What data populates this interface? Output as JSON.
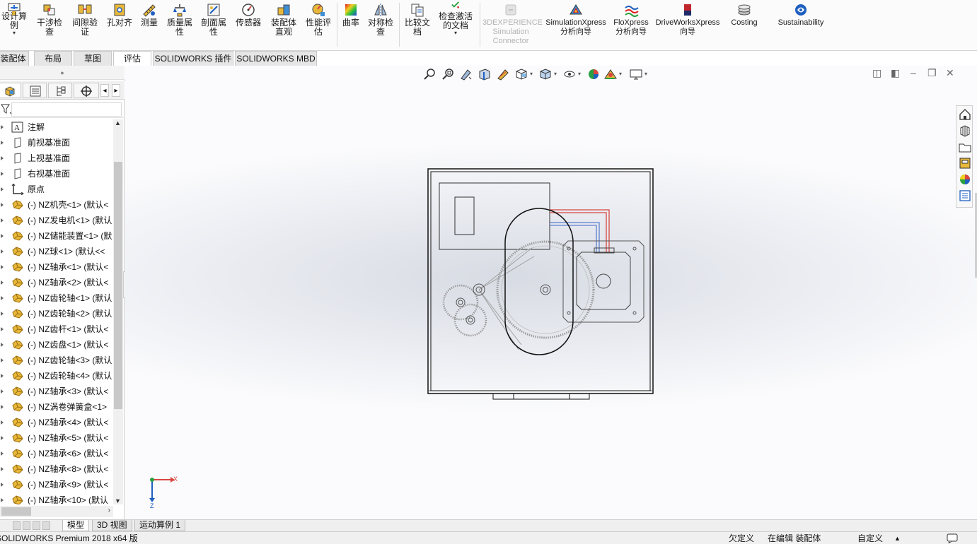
{
  "ribbon": {
    "buttons": [
      {
        "label": "设计算例",
        "icon": "design-study-icon",
        "dropdown": true
      },
      {
        "label": "干涉检查",
        "icon": "interference-check-icon"
      },
      {
        "label": "间隙验证",
        "icon": "clearance-verification-icon"
      },
      {
        "label": "孔对齐",
        "icon": "hole-alignment-icon"
      },
      {
        "label": "测量",
        "icon": "measure-icon"
      },
      {
        "label": "质量属性",
        "icon": "mass-properties-icon"
      },
      {
        "label": "剖面属性",
        "icon": "section-properties-icon"
      },
      {
        "label": "传感器",
        "icon": "sensor-icon"
      },
      {
        "label": "装配体直观",
        "icon": "assemblyxpert-icon"
      },
      {
        "label": "性能评估",
        "icon": "performance-evaluation-icon"
      },
      {
        "label": "曲率",
        "icon": "curvature-icon"
      },
      {
        "label": "对称检查",
        "icon": "symmetry-check-icon"
      },
      {
        "label": "比较文档",
        "icon": "compare-documents-icon"
      },
      {
        "label": "检查激活的文档",
        "icon": "check-active-document-icon",
        "dropdown": true
      },
      {
        "label": "3DEXPERIENCE Simulation Connector",
        "icon": "3dexperience-icon",
        "disabled": true
      },
      {
        "label": "SimulationXpress 分析向导",
        "icon": "simulationxpress-icon"
      },
      {
        "label": "FloXpress 分析向导",
        "icon": "floxpress-icon"
      },
      {
        "label": "DriveWorksXpress 向导",
        "icon": "driveworksxpress-icon"
      },
      {
        "label": "Costing",
        "icon": "costing-icon"
      },
      {
        "label": "Sustainability",
        "icon": "sustainability-icon"
      }
    ]
  },
  "tabs": [
    {
      "label": "装配体"
    },
    {
      "label": "布局"
    },
    {
      "label": "草图"
    },
    {
      "label": "评估",
      "active": true
    },
    {
      "label": "SOLIDWORKS 插件"
    },
    {
      "label": "SOLIDWORKS MBD"
    }
  ],
  "tree": {
    "items": [
      {
        "label": "注解",
        "icon": "annotation-icon"
      },
      {
        "label": "前视基准面",
        "icon": "plane-icon"
      },
      {
        "label": "上视基准面",
        "icon": "plane-icon"
      },
      {
        "label": "右视基准面",
        "icon": "plane-icon"
      },
      {
        "label": "原点",
        "icon": "origin-icon"
      },
      {
        "label": "(-) NZ机壳<1> (默认<",
        "icon": "part-icon"
      },
      {
        "label": "(-) NZ发电机<1> (默认",
        "icon": "part-icon"
      },
      {
        "label": "(-) NZ储能装置<1> (默",
        "icon": "part-icon"
      },
      {
        "label": "(-) NZ球<1> (默认<<",
        "icon": "part-icon"
      },
      {
        "label": "(-) NZ轴承<1> (默认<",
        "icon": "part-icon"
      },
      {
        "label": "(-) NZ轴承<2> (默认<",
        "icon": "part-icon"
      },
      {
        "label": "(-) NZ齿轮轴<1> (默认",
        "icon": "part-icon"
      },
      {
        "label": "(-) NZ齿轮轴<2> (默认",
        "icon": "part-icon"
      },
      {
        "label": "(-) NZ齿杆<1> (默认<",
        "icon": "part-icon"
      },
      {
        "label": "(-) NZ齿盘<1> (默认<",
        "icon": "part-icon"
      },
      {
        "label": "(-) NZ齿轮轴<3> (默认",
        "icon": "part-icon"
      },
      {
        "label": "(-) NZ齿轮轴<4> (默认",
        "icon": "part-icon"
      },
      {
        "label": "(-) NZ轴承<3> (默认<",
        "icon": "part-icon"
      },
      {
        "label": "(-) NZ涡卷弹簧盒<1>",
        "icon": "part-icon"
      },
      {
        "label": "(-) NZ轴承<4> (默认<",
        "icon": "part-icon"
      },
      {
        "label": "(-) NZ轴承<5> (默认<",
        "icon": "part-icon"
      },
      {
        "label": "(-) NZ轴承<6> (默认<",
        "icon": "part-icon"
      },
      {
        "label": "(-) NZ轴承<8> (默认<",
        "icon": "part-icon"
      },
      {
        "label": "(-) NZ轴承<9> (默认<",
        "icon": "part-icon"
      },
      {
        "label": "(-) NZ轴承<10> (默认",
        "icon": "part-icon"
      }
    ]
  },
  "triad": {
    "x_label": "X",
    "z_label": "Z"
  },
  "bottom_tabs": [
    {
      "label": "模型",
      "active": true
    },
    {
      "label": "3D 视图"
    },
    {
      "label": "运动算例 1"
    }
  ],
  "status": {
    "app": "SOLIDWORKS Premium 2018 x64 版",
    "constraint": "欠定义",
    "mode": "在编辑 装配体",
    "units": "自定义"
  },
  "colors": {
    "wire_red": "#d9463f",
    "wire_blue": "#5b7fcf",
    "accent_blue": "#1f5fbf",
    "part_yellow": "#e8b83a"
  }
}
